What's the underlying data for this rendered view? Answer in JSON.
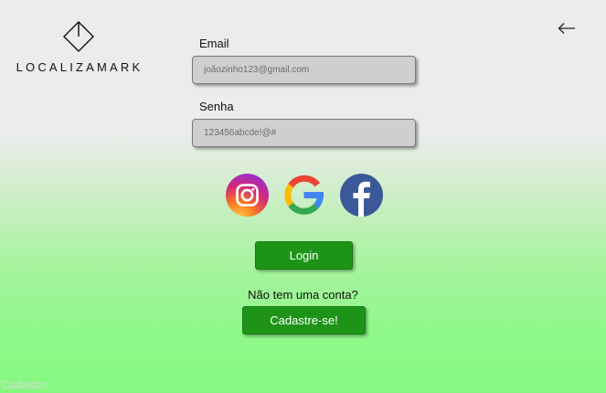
{
  "brand": {
    "name": "LOCALIZAMARK"
  },
  "nav": {
    "back_icon": "arrow-left-icon"
  },
  "form": {
    "email": {
      "label": "Email",
      "value": "joãozinho123@gmail.com"
    },
    "password": {
      "label": "Senha",
      "value": "123456abcde!@#"
    }
  },
  "social": [
    {
      "name": "instagram",
      "icon": "instagram-icon"
    },
    {
      "name": "google",
      "icon": "google-icon"
    },
    {
      "name": "facebook",
      "icon": "facebook-icon"
    }
  ],
  "actions": {
    "login_label": "Login",
    "signup_prompt": "Não tem uma conta?",
    "signup_label": "Cadastre-se!"
  },
  "frame": {
    "label": "Cadastro"
  },
  "colors": {
    "button": "#1d9418",
    "input_bg": "#cfcfcf",
    "gradient_bottom": "#86f882"
  }
}
